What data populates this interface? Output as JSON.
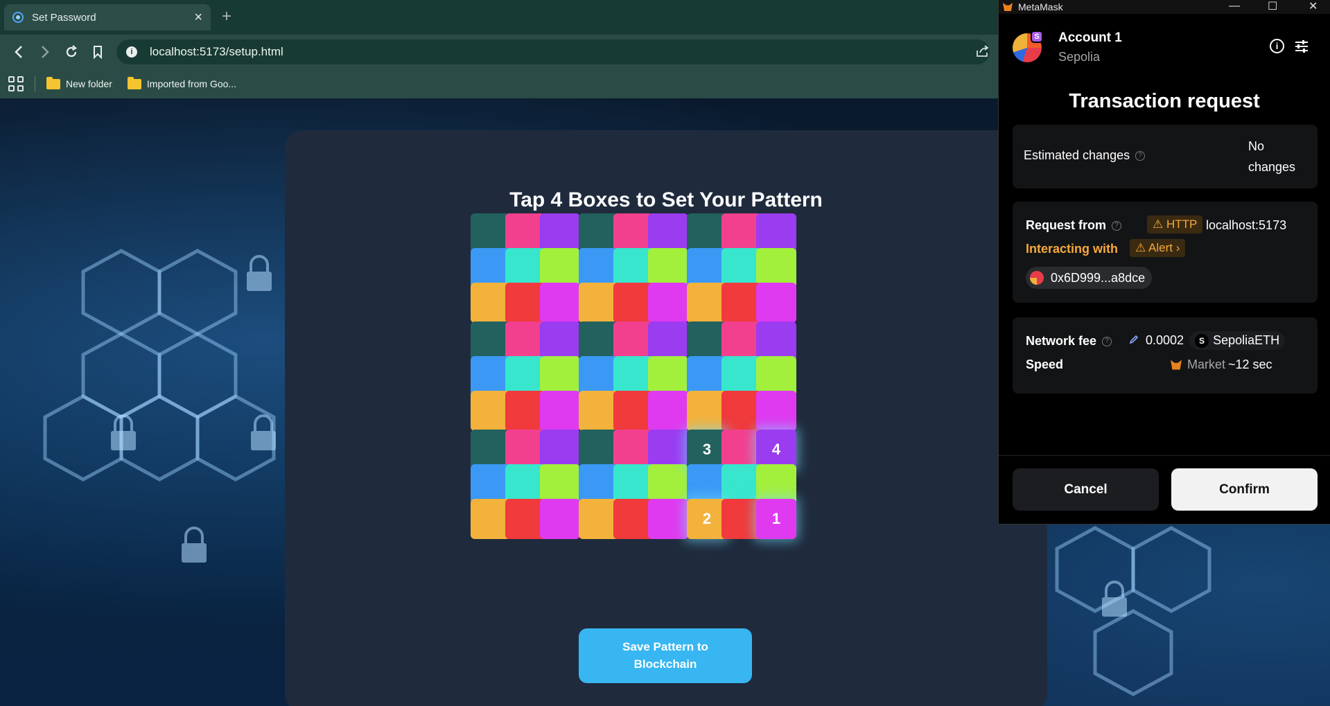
{
  "browser": {
    "tab_title": "Set Password",
    "tab_close": "×",
    "new_tab": "+",
    "url": "localhost:5173/setup.html",
    "bookmarks": [
      "New folder",
      "Imported from Goo..."
    ]
  },
  "page": {
    "title": "Tap 4 Boxes to Set Your Pattern",
    "save_button": "Save Pattern to Blockchain",
    "block_colors": [
      "#23615f",
      "#f2408f",
      "#9a3cf0",
      "#3b99f5",
      "#37e6cc",
      "#a2ef3c",
      "#f3b23c",
      "#f03a3c",
      "#df3af0"
    ],
    "selections": [
      {
        "block": 8,
        "cell": 0,
        "label": "3"
      },
      {
        "block": 8,
        "cell": 2,
        "label": "4"
      },
      {
        "block": 8,
        "cell": 6,
        "label": "2"
      },
      {
        "block": 8,
        "cell": 8,
        "label": "1"
      }
    ]
  },
  "metamask": {
    "window_title": "MetaMask",
    "account_name": "Account 1",
    "network": "Sepolia",
    "network_badge": "S",
    "title": "Transaction request",
    "estimated_changes_label": "Estimated changes",
    "estimated_changes_value": "No changes",
    "request_from_label": "Request from",
    "http_badge": "⚠ HTTP",
    "request_origin": "localhost:5173",
    "interacting_with_label": "Interacting with",
    "alert_badge": "⚠ Alert ›",
    "contract_address": "0x6D999...a8dce",
    "network_fee_label": "Network fee",
    "network_fee_value": "0.0002",
    "fee_token": "SepoliaETH",
    "fee_token_letter": "S",
    "speed_label": "Speed",
    "speed_mode": "Market",
    "speed_time": "~12 sec",
    "cancel_label": "Cancel",
    "confirm_label": "Confirm"
  }
}
